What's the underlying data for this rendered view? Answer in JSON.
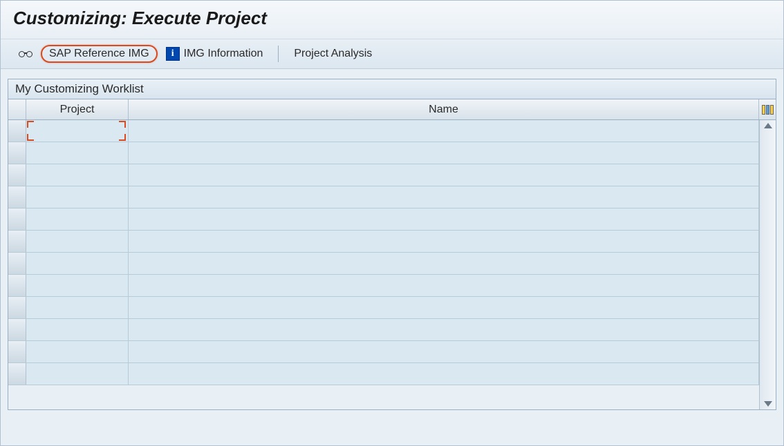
{
  "header": {
    "title": "Customizing: Execute Project"
  },
  "toolbar": {
    "sap_ref_label": "SAP Reference IMG",
    "img_info_label": "IMG Information",
    "project_analysis_label": "Project Analysis"
  },
  "panel": {
    "title": "My Customizing Worklist",
    "columns": {
      "project": "Project",
      "name": "Name"
    },
    "rows": [
      {
        "project": "",
        "name": ""
      },
      {
        "project": "",
        "name": ""
      },
      {
        "project": "",
        "name": ""
      },
      {
        "project": "",
        "name": ""
      },
      {
        "project": "",
        "name": ""
      },
      {
        "project": "",
        "name": ""
      },
      {
        "project": "",
        "name": ""
      },
      {
        "project": "",
        "name": ""
      },
      {
        "project": "",
        "name": ""
      },
      {
        "project": "",
        "name": ""
      },
      {
        "project": "",
        "name": ""
      },
      {
        "project": "",
        "name": ""
      }
    ]
  }
}
